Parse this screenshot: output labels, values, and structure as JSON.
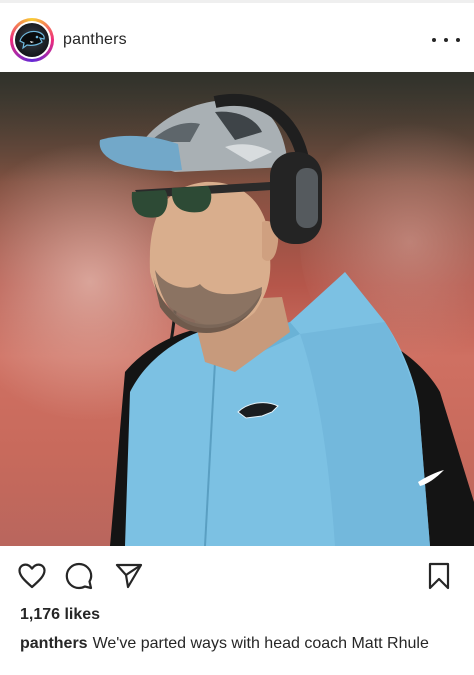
{
  "post": {
    "username": "panthers",
    "likes_text": "1,176 likes",
    "caption_username": "panthers",
    "caption_text": "We've parted ways with head coach Matt Rhule"
  },
  "icons": {
    "avatar": "panthers-logo-icon",
    "more": "more-options-icon",
    "like": "heart-icon",
    "comment": "comment-bubble-icon",
    "share": "paper-plane-icon",
    "save": "bookmark-icon"
  },
  "colors": {
    "text": "#262626",
    "vest": "#7cc1e3",
    "story_ring": "#ee2a7b"
  }
}
